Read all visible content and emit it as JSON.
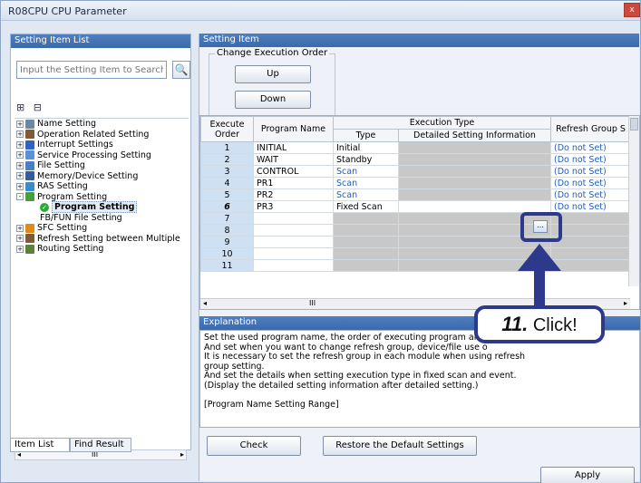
{
  "window": {
    "title": "R08CPU CPU Parameter",
    "close_glyph": "x"
  },
  "left_pane": {
    "header": "Setting Item List",
    "search_placeholder": "Input the Setting Item to Search",
    "search_icon": "binoculars-icon",
    "toolbar_icons": [
      "expand-all-icon",
      "collapse-all-icon"
    ],
    "tree": [
      {
        "label": "Name Setting",
        "icon": "table-icon",
        "color": "#6d86a6",
        "expander": "+"
      },
      {
        "label": "Operation Related Setting",
        "icon": "cpu-icon",
        "color": "#7f5a36",
        "expander": "+"
      },
      {
        "label": "Interrupt Settings",
        "icon": "interrupt-icon",
        "color": "#2f64c1",
        "expander": "+"
      },
      {
        "label": "Service Processing Setting",
        "icon": "service-icon",
        "color": "#5b8fd6",
        "expander": "+"
      },
      {
        "label": "File Setting",
        "icon": "file-icon",
        "color": "#4a7fc4",
        "expander": "+"
      },
      {
        "label": "Memory/Device Setting",
        "icon": "memory-icon",
        "color": "#345d9c",
        "expander": "+"
      },
      {
        "label": "RAS Setting",
        "icon": "ras-icon",
        "color": "#3a8ad0",
        "expander": "+"
      },
      {
        "label": "Program Setting",
        "icon": "program-icon",
        "color": "#4a9d3c",
        "expander": "-"
      },
      {
        "label": "Program Setting",
        "icon": "check-icon",
        "color": "#2fa83a",
        "expander": "",
        "child": true,
        "selected": true
      },
      {
        "label": "FB/FUN File Setting",
        "icon": "",
        "color": "",
        "expander": "",
        "child": true
      },
      {
        "label": "SFC Setting",
        "icon": "sfc-icon",
        "color": "#e08a1c",
        "expander": "+"
      },
      {
        "label": "Refresh Setting between Multiple",
        "icon": "refresh-icon",
        "color": "#7f5a36",
        "expander": "+"
      },
      {
        "label": "Routing Setting",
        "icon": "routing-icon",
        "color": "#5f7f3a",
        "expander": "+"
      }
    ],
    "tabs": [
      "Item List",
      "Find Result"
    ],
    "scroll_glyph": "III"
  },
  "right_pane": {
    "header": "Setting Item",
    "change_order": {
      "legend": "Change Execution Order",
      "up": "Up",
      "down": "Down"
    },
    "grid": {
      "col_execute_order": "Execute Order",
      "col_program_name": "Program Name",
      "col_execution_type": "Execution Type",
      "col_type": "Type",
      "col_detail": "Detailed Setting Information",
      "col_refresh": "Refresh Group S",
      "rows": [
        {
          "order": "1",
          "name": "INITIAL",
          "type": "Initial",
          "type_blue": false,
          "refresh": "(Do not Set)"
        },
        {
          "order": "2",
          "name": "WAIT",
          "type": "Standby",
          "type_blue": false,
          "refresh": "(Do not Set)"
        },
        {
          "order": "3",
          "name": "CONTROL",
          "type": "Scan",
          "type_blue": true,
          "refresh": "(Do not Set)"
        },
        {
          "order": "4",
          "name": "PR1",
          "type": "Scan",
          "type_blue": true,
          "refresh": "(Do not Set)"
        },
        {
          "order": "5",
          "name": "PR2",
          "type": "Scan",
          "type_blue": true,
          "refresh": "(Do not Set)"
        },
        {
          "order": "6",
          "name": "PR3",
          "type": "Fixed Scan",
          "type_blue": false,
          "refresh": "(Do not Set)",
          "current": true
        },
        {
          "order": "7",
          "name": "",
          "type": "",
          "refresh": ""
        },
        {
          "order": "8",
          "name": "",
          "type": "",
          "refresh": ""
        },
        {
          "order": "9",
          "name": "",
          "type": "",
          "refresh": ""
        },
        {
          "order": "10",
          "name": "",
          "type": "",
          "refresh": ""
        },
        {
          "order": "11",
          "name": "",
          "type": "",
          "refresh": ""
        }
      ],
      "scroll_glyph": "III"
    },
    "explanation": {
      "header": "Explanation",
      "lines": [
        "Set the used program name, the order of executing program and e",
        "And set when you want to change refresh group, device/file use o",
        "It is necessary to set the refresh group in each module when using refresh",
        "group setting.",
        "And set the details when setting execution type in fixed scan and event.",
        "(Display the detailed setting information after detailed setting.)",
        "",
        "[Program Name Setting Range]"
      ]
    },
    "buttons": {
      "check": "Check",
      "restore": "Restore the Default Settings",
      "apply": "Apply"
    }
  },
  "annotation": {
    "step": "11.",
    "text": "Click!",
    "color": "#2d3a8c"
  }
}
